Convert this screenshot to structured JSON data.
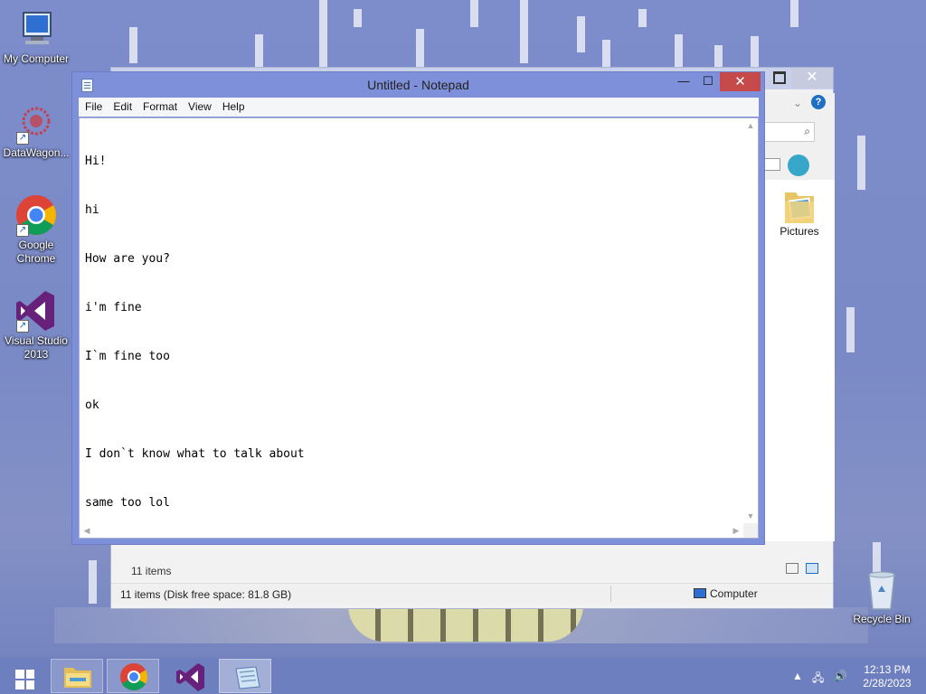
{
  "desktop": {
    "icons": [
      {
        "label": "My Computer"
      },
      {
        "label": "DataWagon..."
      },
      {
        "label": "Google Chrome"
      },
      {
        "label": "Visual Studio 2013"
      },
      {
        "label": "Recycle Bin"
      }
    ]
  },
  "explorer": {
    "folder_label": "Pictures",
    "items_count": "11 items",
    "status_text": "11 items (Disk free space: 81.8 GB)",
    "location": "Computer"
  },
  "notepad": {
    "title": "Untitled - Notepad",
    "menu": [
      "File",
      "Edit",
      "Format",
      "View",
      "Help"
    ],
    "text_lines": [
      "Hi!",
      "hi",
      "How are you?",
      "i'm fine",
      "I`m fine too",
      "ok",
      "I don`t know what to talk about",
      "same too lol"
    ]
  },
  "taskbar": {
    "time": "12:13 PM",
    "date": "2/28/2023",
    "buttons": [
      "file-explorer",
      "google-chrome",
      "visual-studio",
      "notepad"
    ]
  },
  "colors": {
    "desktop": "#7c8cc8",
    "notepad_frame": "#7e90d9",
    "close_button": "#c74a4a",
    "taskbar": "#6d7fbe"
  }
}
